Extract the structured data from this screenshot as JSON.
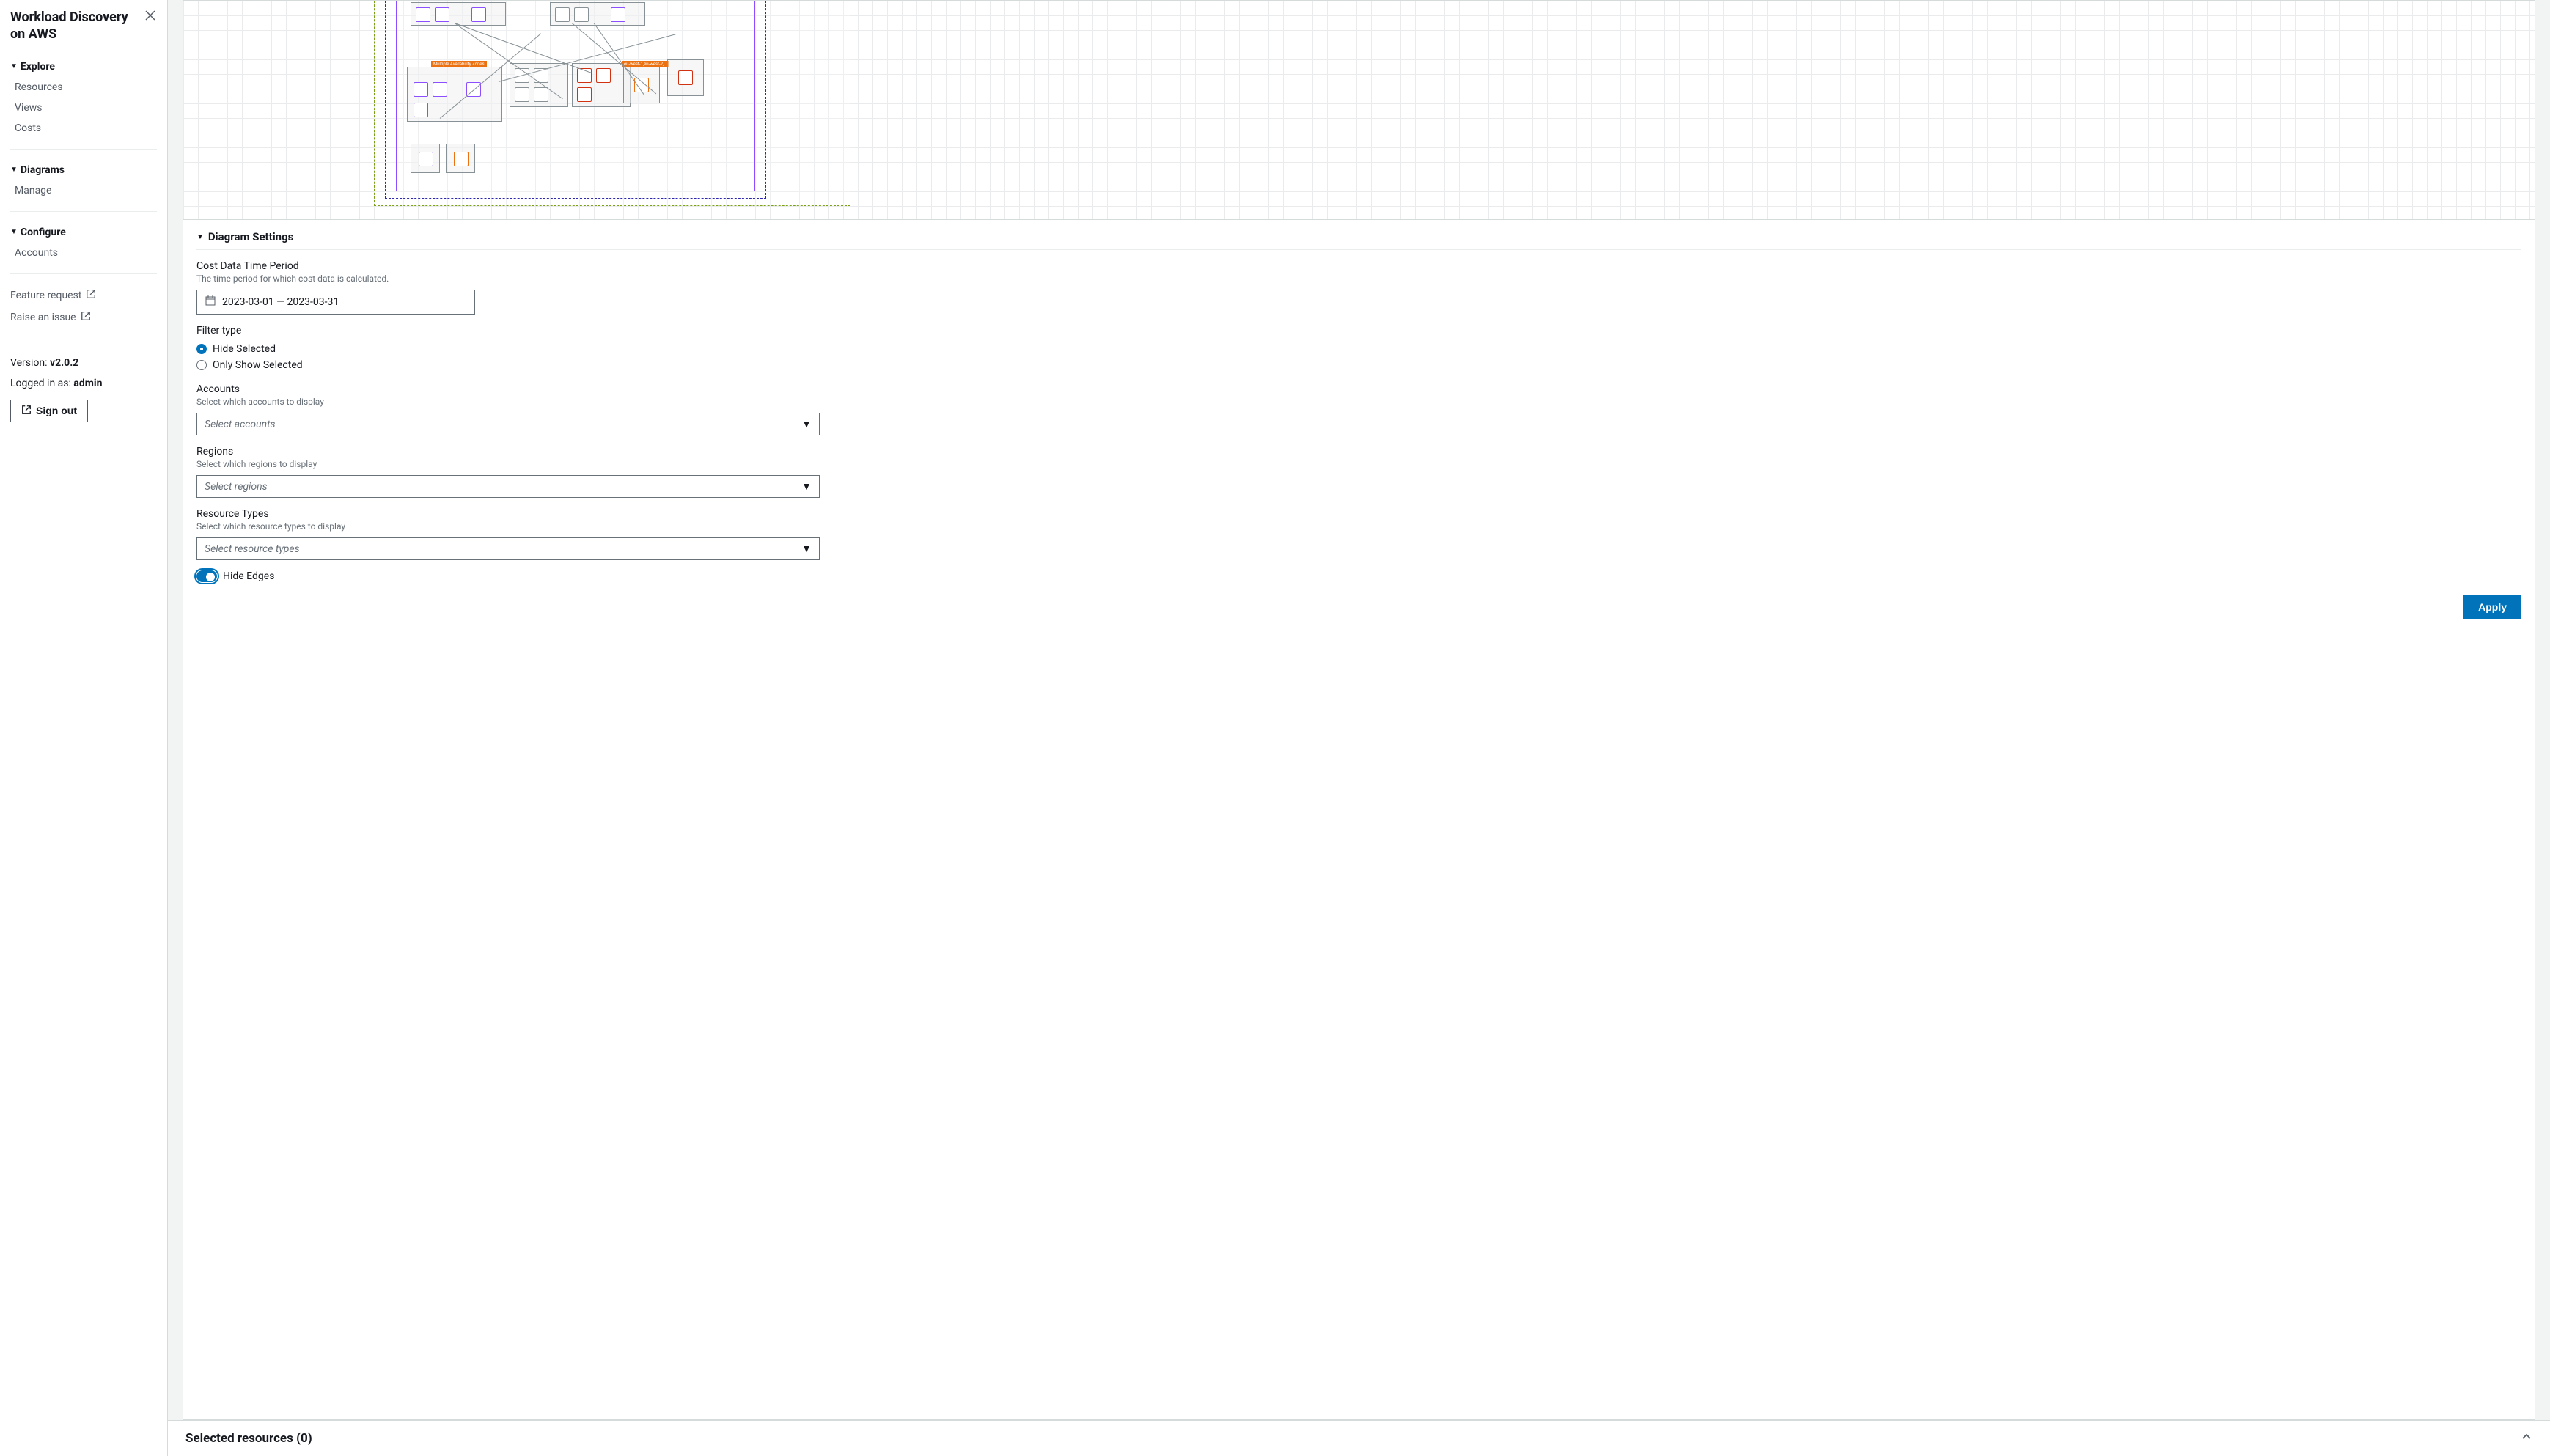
{
  "sidebar": {
    "title": "Workload Discovery on AWS",
    "sections": [
      {
        "label": "Explore",
        "items": [
          "Resources",
          "Views",
          "Costs"
        ]
      },
      {
        "label": "Diagrams",
        "items": [
          "Manage"
        ]
      },
      {
        "label": "Configure",
        "items": [
          "Accounts"
        ]
      }
    ],
    "external_links": [
      "Feature request",
      "Raise an issue"
    ],
    "version_label": "Version: ",
    "version_value": "v2.0.2",
    "login_label": "Logged in as: ",
    "login_value": "admin",
    "signout_label": "Sign out"
  },
  "settings": {
    "header": "Diagram Settings",
    "cost_period": {
      "label": "Cost Data Time Period",
      "help": "The time period for which cost data is calculated.",
      "value": "2023-03-01 — 2023-03-31"
    },
    "filter_type": {
      "label": "Filter type",
      "options": [
        "Hide Selected",
        "Only Show Selected"
      ],
      "selected": 0
    },
    "accounts": {
      "label": "Accounts",
      "help": "Select which accounts to display",
      "placeholder": "Select accounts"
    },
    "regions": {
      "label": "Regions",
      "help": "Select which regions to display",
      "placeholder": "Select regions"
    },
    "resource_types": {
      "label": "Resource Types",
      "help": "Select which resource types to display",
      "placeholder": "Select resource types"
    },
    "hide_edges": {
      "label": "Hide Edges",
      "value": true
    },
    "apply_label": "Apply"
  },
  "bottom": {
    "title": "Selected resources (0)"
  },
  "diagram_labels": {
    "multi_az": "Multiple Availability Zones",
    "region_west": "eu-west-1,eu-west-2,..."
  }
}
